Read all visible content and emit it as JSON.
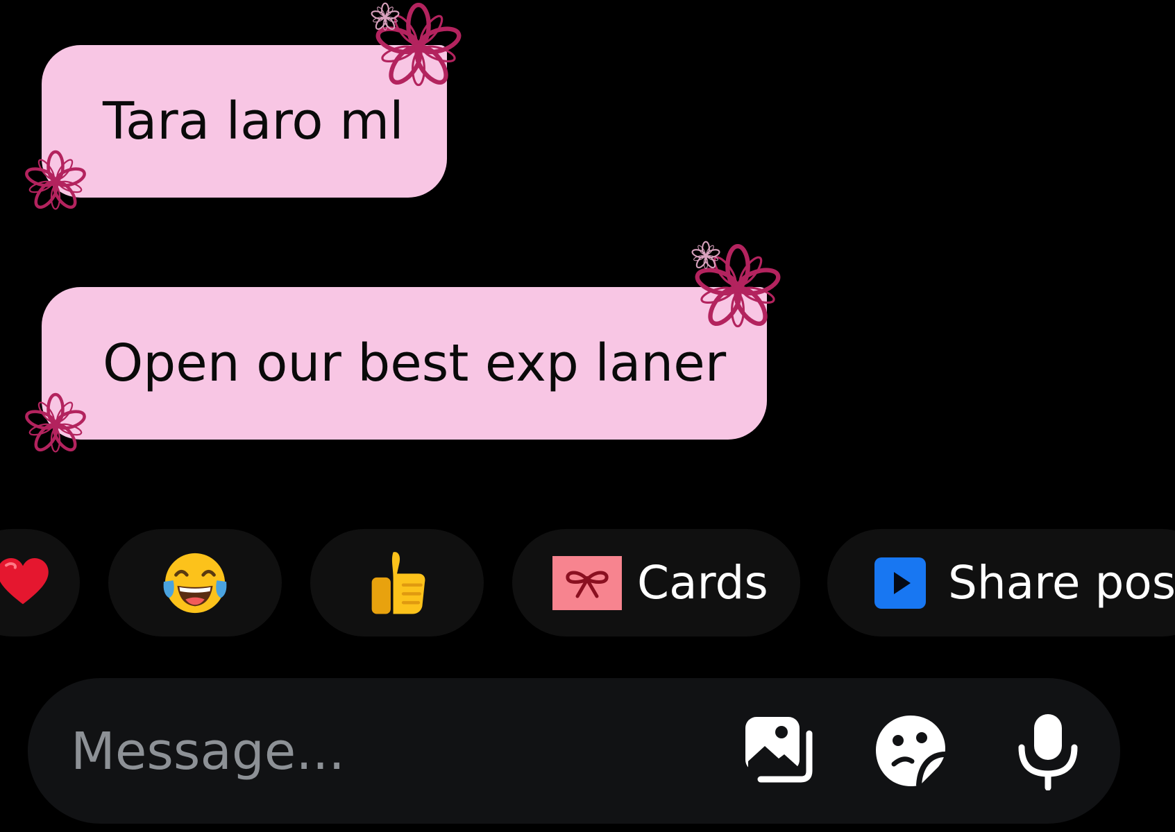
{
  "messages": [
    {
      "text": "Tara laro ml"
    },
    {
      "text": "Open our best exp laner"
    }
  ],
  "quick_replies": {
    "heart_icon": "red-heart-emoji",
    "laugh_icon": "face-with-tears-of-joy-emoji",
    "thumb_icon": "thumbs-up-emoji",
    "cards_icon": "gift-card-bow-icon",
    "cards_label": "Cards",
    "share_icon": "play-square-icon",
    "share_label": "Share post"
  },
  "composer": {
    "placeholder": "Message...",
    "gallery_icon": "gallery-icon",
    "sticker_icon": "sticker-icon",
    "mic_icon": "microphone-icon"
  },
  "colors": {
    "background": "#000000",
    "bubble": "#f8c6e4",
    "flower": "#b3235e",
    "chip": "#101010",
    "composer": "#111214",
    "placeholder": "#8d9196",
    "share_icon": "#1877f2",
    "cards_icon": "#f7848f"
  }
}
